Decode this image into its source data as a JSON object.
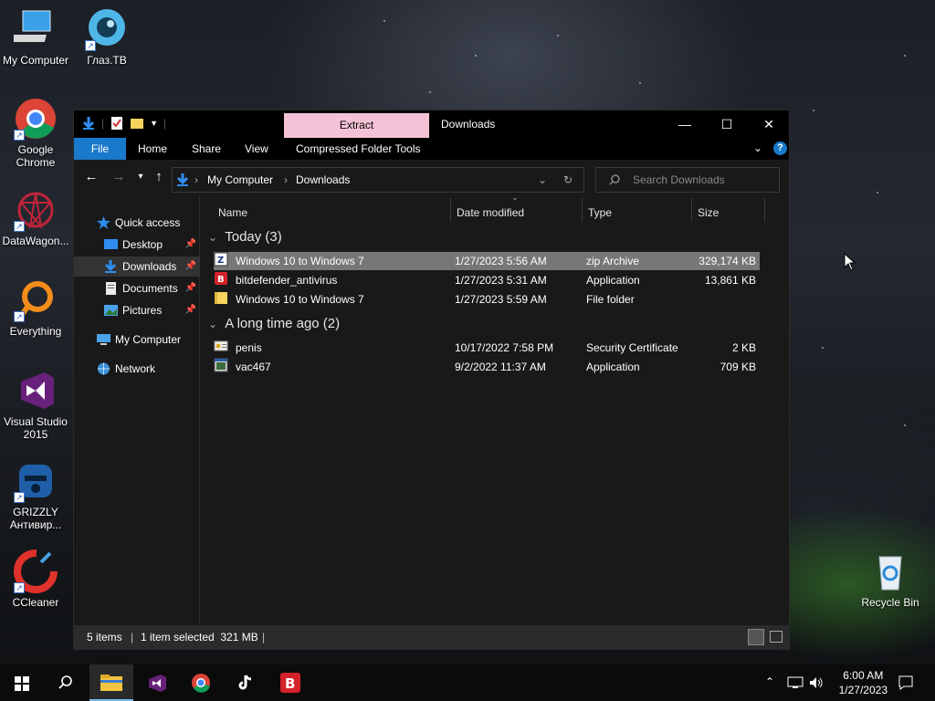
{
  "desktop": {
    "icons": [
      {
        "label": "My Computer"
      },
      {
        "label": "Глаз.ТВ"
      },
      {
        "label": "Google Chrome"
      },
      {
        "label": "DataWagon..."
      },
      {
        "label": "Everything"
      },
      {
        "label": "Visual Studio 2015"
      },
      {
        "label": "GRIZZLY Антивир..."
      },
      {
        "label": "CCleaner"
      },
      {
        "label": "Recycle Bin"
      }
    ]
  },
  "window": {
    "title": "Downloads",
    "context_tab": "Extract",
    "ribbon_tabs": [
      "File",
      "Home",
      "Share",
      "View",
      "Compressed Folder Tools"
    ],
    "breadcrumb": [
      "My Computer",
      "Downloads"
    ],
    "search_placeholder": "Search Downloads",
    "nav": {
      "quick_access": "Quick access",
      "items": [
        "Desktop",
        "Downloads",
        "Documents",
        "Pictures"
      ],
      "my_computer": "My Computer",
      "network": "Network"
    },
    "columns": [
      "Name",
      "Date modified",
      "Type",
      "Size"
    ],
    "groups": [
      {
        "title": "Today (3)",
        "files": [
          {
            "name": "Windows 10 to Windows 7",
            "date": "1/27/2023 5:56 AM",
            "type": "zip Archive",
            "size": "329,174 KB",
            "icon": "zip-icon"
          },
          {
            "name": "bitdefender_antivirus",
            "date": "1/27/2023 5:31 AM",
            "type": "Application",
            "size": "13,861 KB",
            "icon": "bitdefender-icon"
          },
          {
            "name": "Windows 10 to Windows 7",
            "date": "1/27/2023 5:59 AM",
            "type": "File folder",
            "size": "",
            "icon": "folder-icon"
          }
        ]
      },
      {
        "title": "A long time ago (2)",
        "files": [
          {
            "name": "penis",
            "date": "10/17/2022 7:58 PM",
            "type": "Security Certificate",
            "size": "2 KB",
            "icon": "certificate-icon"
          },
          {
            "name": "vac467",
            "date": "9/2/2022 11:37 AM",
            "type": "Application",
            "size": "709 KB",
            "icon": "application-icon"
          }
        ]
      }
    ],
    "status": {
      "items": "5 items",
      "selected": "1 item selected  321 MB"
    }
  },
  "taskbar": {
    "time": "6:00 AM",
    "date": "1/27/2023"
  }
}
